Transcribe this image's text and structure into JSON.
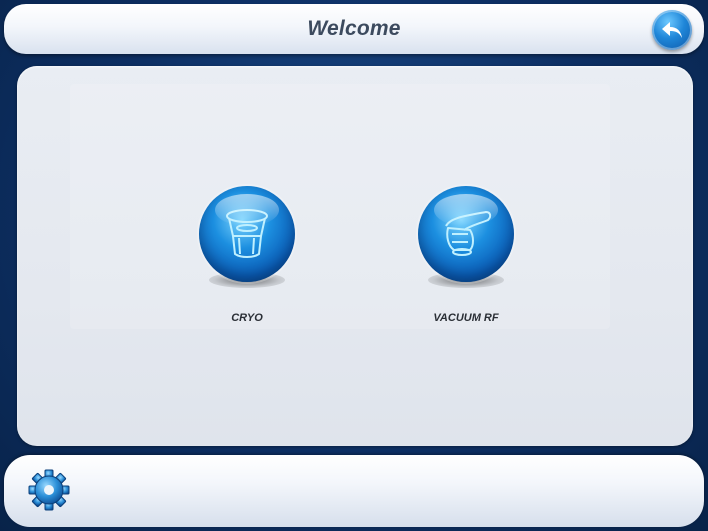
{
  "header": {
    "title": "Welcome",
    "back_icon": "back-arrow-icon"
  },
  "main": {
    "modules": [
      {
        "label": "CRYO",
        "icon": "cryo-handpiece-icon"
      },
      {
        "label": "VACUUM RF",
        "icon": "vacuum-rf-handpiece-icon"
      }
    ]
  },
  "footer": {
    "settings_icon": "gear-icon"
  },
  "colors": {
    "background": "#0d2f63",
    "accent": "#1c8fe0",
    "panel": "#e6eaf0"
  }
}
